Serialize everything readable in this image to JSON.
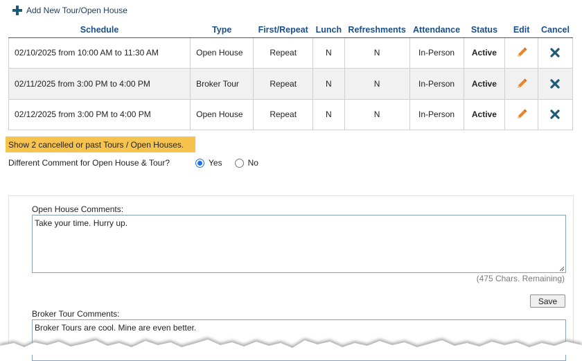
{
  "add_link": {
    "label": "Add New Tour/Open House",
    "icon": "plus-icon"
  },
  "table": {
    "headers": [
      "Schedule",
      "Type",
      "First/Repeat",
      "Lunch",
      "Refreshments",
      "Attendance",
      "Status",
      "Edit",
      "Cancel"
    ],
    "rows": [
      {
        "schedule": "02/10/2025 from 10:00 AM to 11:30 AM",
        "type": "Open House",
        "first_repeat": "Repeat",
        "lunch": "N",
        "refreshments": "N",
        "attendance": "In-Person",
        "status": "Active"
      },
      {
        "schedule": "02/11/2025 from 3:00 PM to 4:00 PM",
        "type": "Broker Tour",
        "first_repeat": "Repeat",
        "lunch": "N",
        "refreshments": "N",
        "attendance": "In-Person",
        "status": "Active"
      },
      {
        "schedule": "02/12/2025 from 3:00 PM to 4:00 PM",
        "type": "Open House",
        "first_repeat": "Repeat",
        "lunch": "N",
        "refreshments": "N",
        "attendance": "In-Person",
        "status": "Active"
      }
    ],
    "edit_icon": "pencil-icon",
    "cancel_icon": "x-icon"
  },
  "show_past": {
    "label": "Show 2 cancelled or past Tours / Open Houses."
  },
  "different_comment": {
    "question": "Different Comment for Open House & Tour?",
    "options": [
      {
        "label": "Yes",
        "checked": true
      },
      {
        "label": "No",
        "checked": false
      }
    ]
  },
  "open_house": {
    "label": "Open House Comments:",
    "value": "Take your time. Hurry up.",
    "chars_remaining": "(475 Chars. Remaining)",
    "save_label": "Save"
  },
  "broker_tour": {
    "label": "Broker Tour Comments:",
    "value": "Broker Tours are cool. Mine are even better."
  },
  "colors": {
    "header": "#1b4f8a",
    "active": "#2e8b24",
    "edit": "#e8872a",
    "cancel": "#1c5a78",
    "banner": "#f6c44e"
  }
}
